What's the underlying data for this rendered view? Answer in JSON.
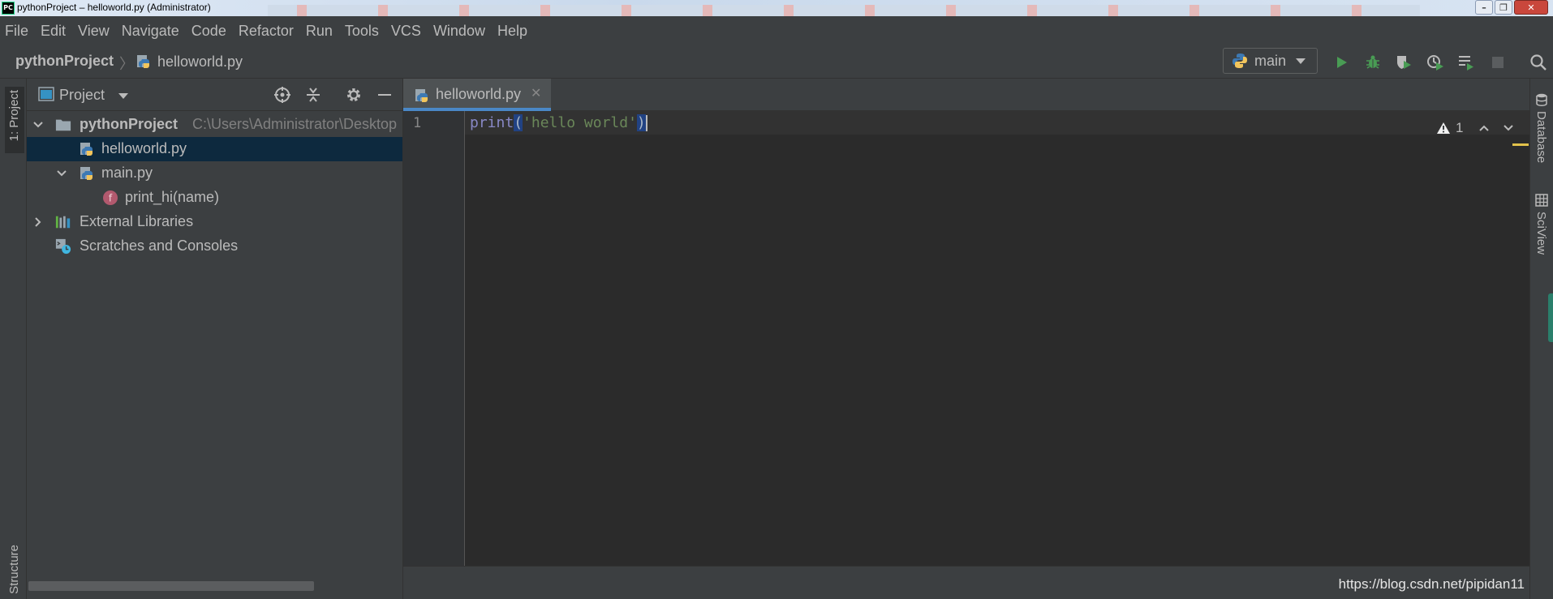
{
  "window": {
    "title": "pythonProject – helloworld.py (Administrator)",
    "app_icon": "PC"
  },
  "menu": [
    "File",
    "Edit",
    "View",
    "Navigate",
    "Code",
    "Refactor",
    "Run",
    "Tools",
    "VCS",
    "Window",
    "Help"
  ],
  "navbar": {
    "project": "pythonProject",
    "file": "helloworld.py",
    "run_config": "main"
  },
  "project_panel": {
    "title": "Project",
    "tree": [
      {
        "label": "pythonProject",
        "path": "C:\\Users\\Administrator\\Desktop",
        "icon": "folder-icon",
        "expanded": true
      },
      {
        "label": "helloworld.py",
        "icon": "python-file-icon",
        "selected": true
      },
      {
        "label": "main.py",
        "icon": "python-file-icon",
        "expanded": true
      },
      {
        "label": "print_hi(name)",
        "icon": "function-icon"
      },
      {
        "label": "External Libraries",
        "icon": "libraries-icon",
        "expanded": false
      },
      {
        "label": "Scratches and Consoles",
        "icon": "scratches-icon"
      }
    ]
  },
  "left_stripe": {
    "project_tab": "1: Project",
    "structure_tab": "Structure"
  },
  "editor": {
    "tab_label": "helloworld.py",
    "line_number": "1",
    "code": {
      "fn": "print",
      "open": "(",
      "str": "'hello world'",
      "close": ")"
    },
    "warnings": "1"
  },
  "right_stripe": {
    "database": "Database",
    "sciview": "SciView"
  },
  "watermark": "https://blog.csdn.net/pipidan11",
  "colors": {
    "accent": "#4a88c7",
    "run_green": "#499c54",
    "selection": "#0d293e",
    "background": "#2b2b2b"
  }
}
